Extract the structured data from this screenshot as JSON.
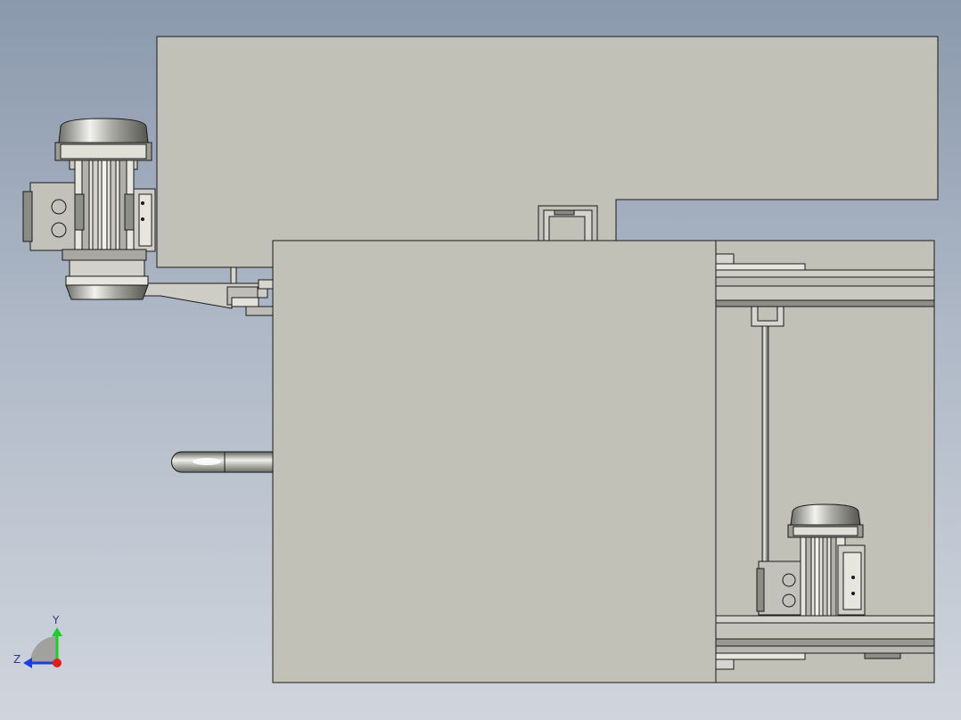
{
  "view": {
    "background_top": "#8b99ad",
    "background_bottom": "#d0d5dd",
    "part_fill": "#c1c1b8",
    "edge_color": "#1a1a1a"
  },
  "triad": {
    "y_label": "Y",
    "z_label": "Z",
    "y_color": "#1fcc2a",
    "z_color": "#1e3fe0",
    "x_color": "#e01e1e"
  },
  "icons": [
    "motor-icon",
    "coordinate-triad-icon"
  ]
}
